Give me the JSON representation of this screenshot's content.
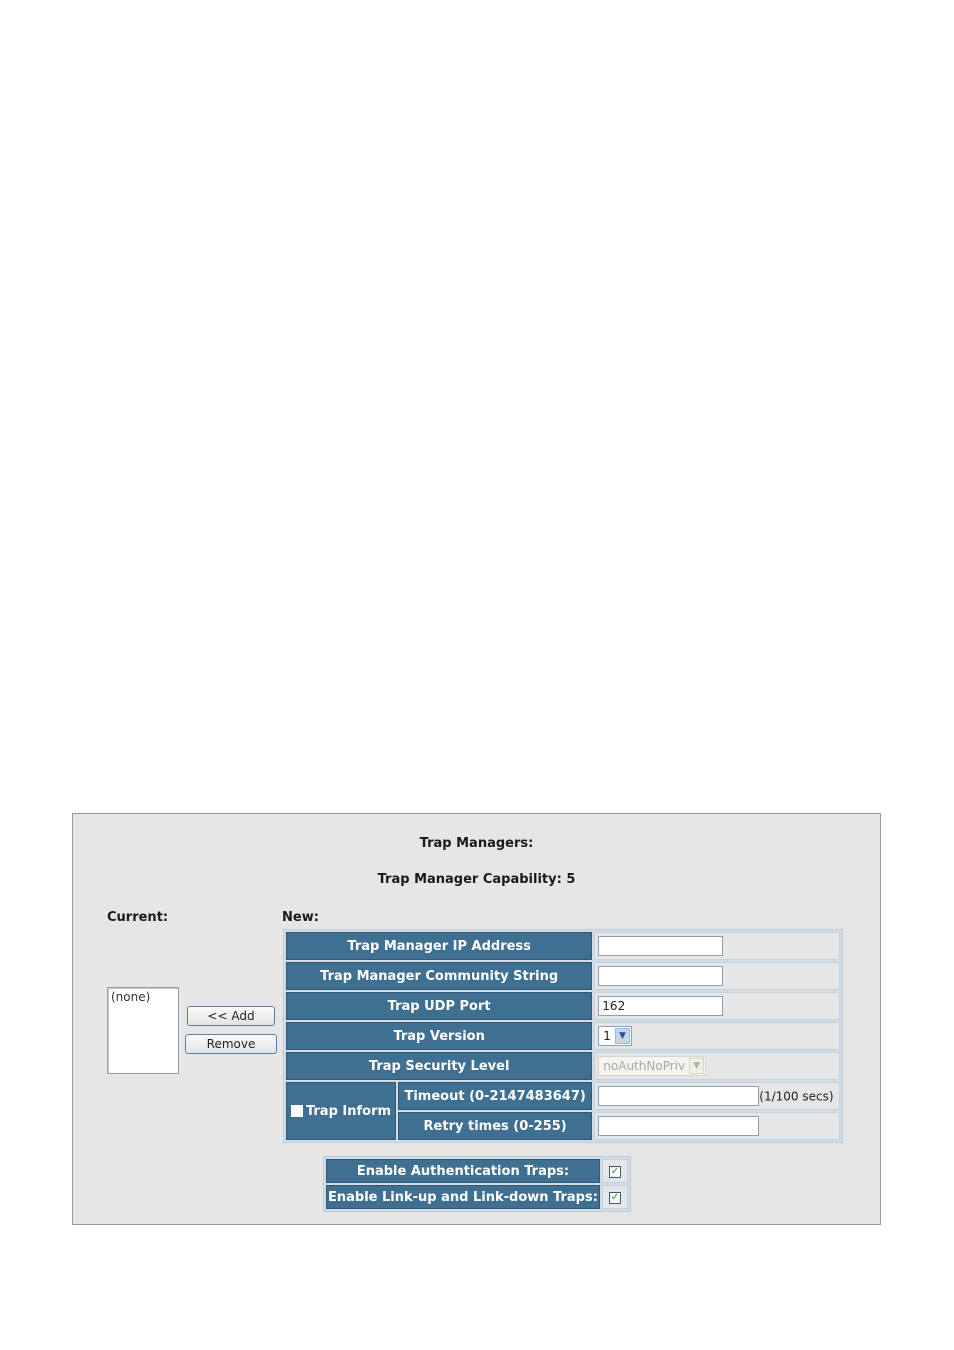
{
  "panel": {
    "title": "Trap Managers:",
    "capability": "Trap Manager Capability: 5",
    "current_label": "Current:",
    "new_label": "New:"
  },
  "current": {
    "list_items": [
      "(none)"
    ],
    "add_button": "<< Add",
    "remove_button": "Remove"
  },
  "form": {
    "ip_label": "Trap Manager IP Address",
    "ip_value": "",
    "community_label": "Trap Manager Community String",
    "community_value": "",
    "udp_label": "Trap UDP Port",
    "udp_value": "162",
    "version_label": "Trap Version",
    "version_value": "1",
    "security_label": "Trap Security Level",
    "security_value": "noAuthNoPriv",
    "security_disabled": true,
    "inform_label": "Trap Inform",
    "inform_checked": false,
    "timeout_label": "Timeout (0-2147483647)",
    "timeout_value": "",
    "timeout_unit": "(1/100 secs)",
    "retry_label": "Retry times (0-255)",
    "retry_value": ""
  },
  "traps": {
    "auth_label": "Enable Authentication Traps:",
    "auth_checked": true,
    "link_label": "Enable Link-up and Link-down Traps:",
    "link_checked": true,
    "check_glyph": "✓"
  }
}
